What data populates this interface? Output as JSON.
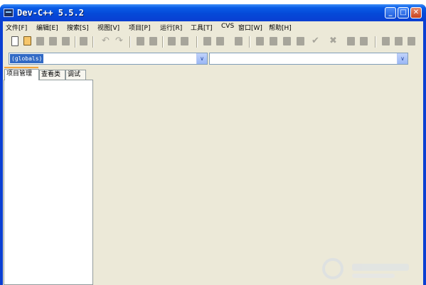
{
  "window": {
    "title": "Dev-C++ 5.5.2"
  },
  "title_buttons": {
    "minimize": "_",
    "maximize": "□",
    "close": "✕"
  },
  "menu": [
    "文件[F]",
    "编辑[E]",
    "搜索[S]",
    "视图[V]",
    "项目[P]",
    "运行[R]",
    "工具[T]",
    "CVS",
    "窗口[W]",
    "帮助[H]"
  ],
  "toolbar": {
    "undo_glyph": "↶",
    "redo_glyph": "↷",
    "check_glyph": "✔",
    "cross_glyph": "✖"
  },
  "scope_combo": {
    "value": "(globals)",
    "arrow": "∨"
  },
  "symbol_combo": {
    "value": "",
    "arrow": "∨"
  },
  "tabs": [
    "项目管理",
    "查看类",
    "调试"
  ],
  "colors": {
    "titlebar": "#0a5ce6",
    "client": "#ece9d8",
    "selection": "#316ac5",
    "tab_accent": "#f4a53a"
  },
  "icons": {
    "app": "dev-cpp-app-icon",
    "new": "new-file-icon",
    "open": "open-project-icon"
  }
}
